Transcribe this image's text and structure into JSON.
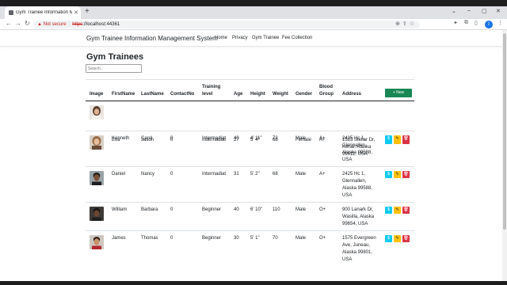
{
  "browser": {
    "tab_title": "Gym Trainee Information Manag...",
    "tab_close": "✕",
    "new_tab": "+",
    "window_controls": [
      "⌄",
      "–",
      "▢",
      "✕"
    ],
    "warning_icon": "warning-icon",
    "not_secure": "Not secure",
    "url_scheme": "https",
    "url_rest": "://localhost:44361",
    "profile_initial": "I"
  },
  "navbar": {
    "brand": "Gym Trainee Information Management System",
    "links": [
      "Home",
      "Privacy",
      "Gym Trainee",
      "Fee Collection"
    ]
  },
  "page": {
    "title": "Gym Trainees",
    "search_placeholder": "Search..",
    "new_button": "+ New"
  },
  "table": {
    "headers": {
      "image": "Image",
      "firstname": "FirstName",
      "lastname": "LastName",
      "contact": "ContactNo",
      "training1": "Training",
      "training2": "level",
      "age": "Age",
      "height": "Height",
      "weight": "Weight",
      "gender": "Gender",
      "blood1": "Blood",
      "blood2": "Group",
      "address": "Address"
    },
    "rows": [
      {
        "first": "Eva",
        "last": "Jason",
        "contact": "0",
        "level": "Intermadiat",
        "age": "27",
        "height": "5' 4''",
        "weight": "68",
        "gender": "Female",
        "blood": "A+",
        "address": [
          "1523 Stellar Dr,",
          "Kenai, Alaska",
          "99611, USA"
        ]
      },
      {
        "first": "Kenneth",
        "last": "Carol",
        "contact": "0",
        "level": "Intermadiat",
        "age": "40",
        "height": "4' 11''",
        "weight": "72",
        "gender": "Male",
        "blood": "A+",
        "address": [
          "2425 Hc 1,",
          "Glennallen,",
          "Alaska 99588,",
          "USA"
        ]
      },
      {
        "first": "Daniel",
        "last": "Nancy",
        "contact": "0",
        "level": "Intermadiat",
        "age": "31",
        "height": "5' 2''",
        "weight": "68",
        "gender": "Male",
        "blood": "A+",
        "address": [
          "2425 Hc 1,",
          "Glennallen,",
          "Alaska 99588,",
          "USA"
        ]
      },
      {
        "first": "William",
        "last": "Barbara",
        "contact": "0",
        "level": "Beginner",
        "age": "40",
        "height": "6' 10''",
        "weight": "110",
        "gender": "Male",
        "blood": "O+",
        "address": [
          "900 Lanark Dr,",
          "Wasilla, Alaska",
          "99654, USA"
        ]
      },
      {
        "first": "James",
        "last": "Thomas",
        "contact": "0",
        "level": "Beginner",
        "age": "30",
        "height": "5' 1''",
        "weight": "70",
        "gender": "Male",
        "blood": "O+",
        "address": [
          "1575 Evergreen",
          "Ave, Juneau,",
          "Alaska 99801,",
          "USA"
        ]
      }
    ],
    "actions": {
      "pay": "$",
      "edit": "✎",
      "delete": "🗑"
    }
  },
  "colors": {
    "new_button": "#198754",
    "pay_button": "#0dcaf0",
    "edit_button": "#ffc107",
    "delete_button": "#dc3545"
  }
}
